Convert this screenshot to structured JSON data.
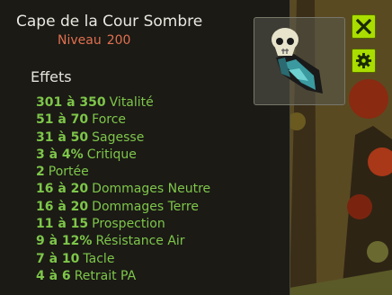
{
  "item": {
    "name": "Cape de la Cour Sombre",
    "level_label": "Niveau",
    "level_value": "200"
  },
  "effects_title": "Effets",
  "effects": [
    {
      "value": "301 à 350",
      "stat": "Vitalité"
    },
    {
      "value": "51 à 70",
      "stat": "Force"
    },
    {
      "value": "31 à 50",
      "stat": "Sagesse"
    },
    {
      "value": "3 à 4%",
      "stat": "Critique"
    },
    {
      "value": "2",
      "stat": "Portée"
    },
    {
      "value": "16 à 20",
      "stat": "Dommages Neutre"
    },
    {
      "value": "16 à 20",
      "stat": "Dommages Terre"
    },
    {
      "value": "11 à 15",
      "stat": "Prospection"
    },
    {
      "value": "9 à 12%",
      "stat": "Résistance Air"
    },
    {
      "value": "7 à 10",
      "stat": "Tacle"
    },
    {
      "value": "4 à 6",
      "stat": "Retrait PA"
    }
  ],
  "colors": {
    "effect_text": "#7ec64a",
    "level_text": "#e07050",
    "button": "#aadd00"
  },
  "icons": {
    "item_image": "cape-icon",
    "close": "close-icon",
    "settings": "gear-icon"
  }
}
